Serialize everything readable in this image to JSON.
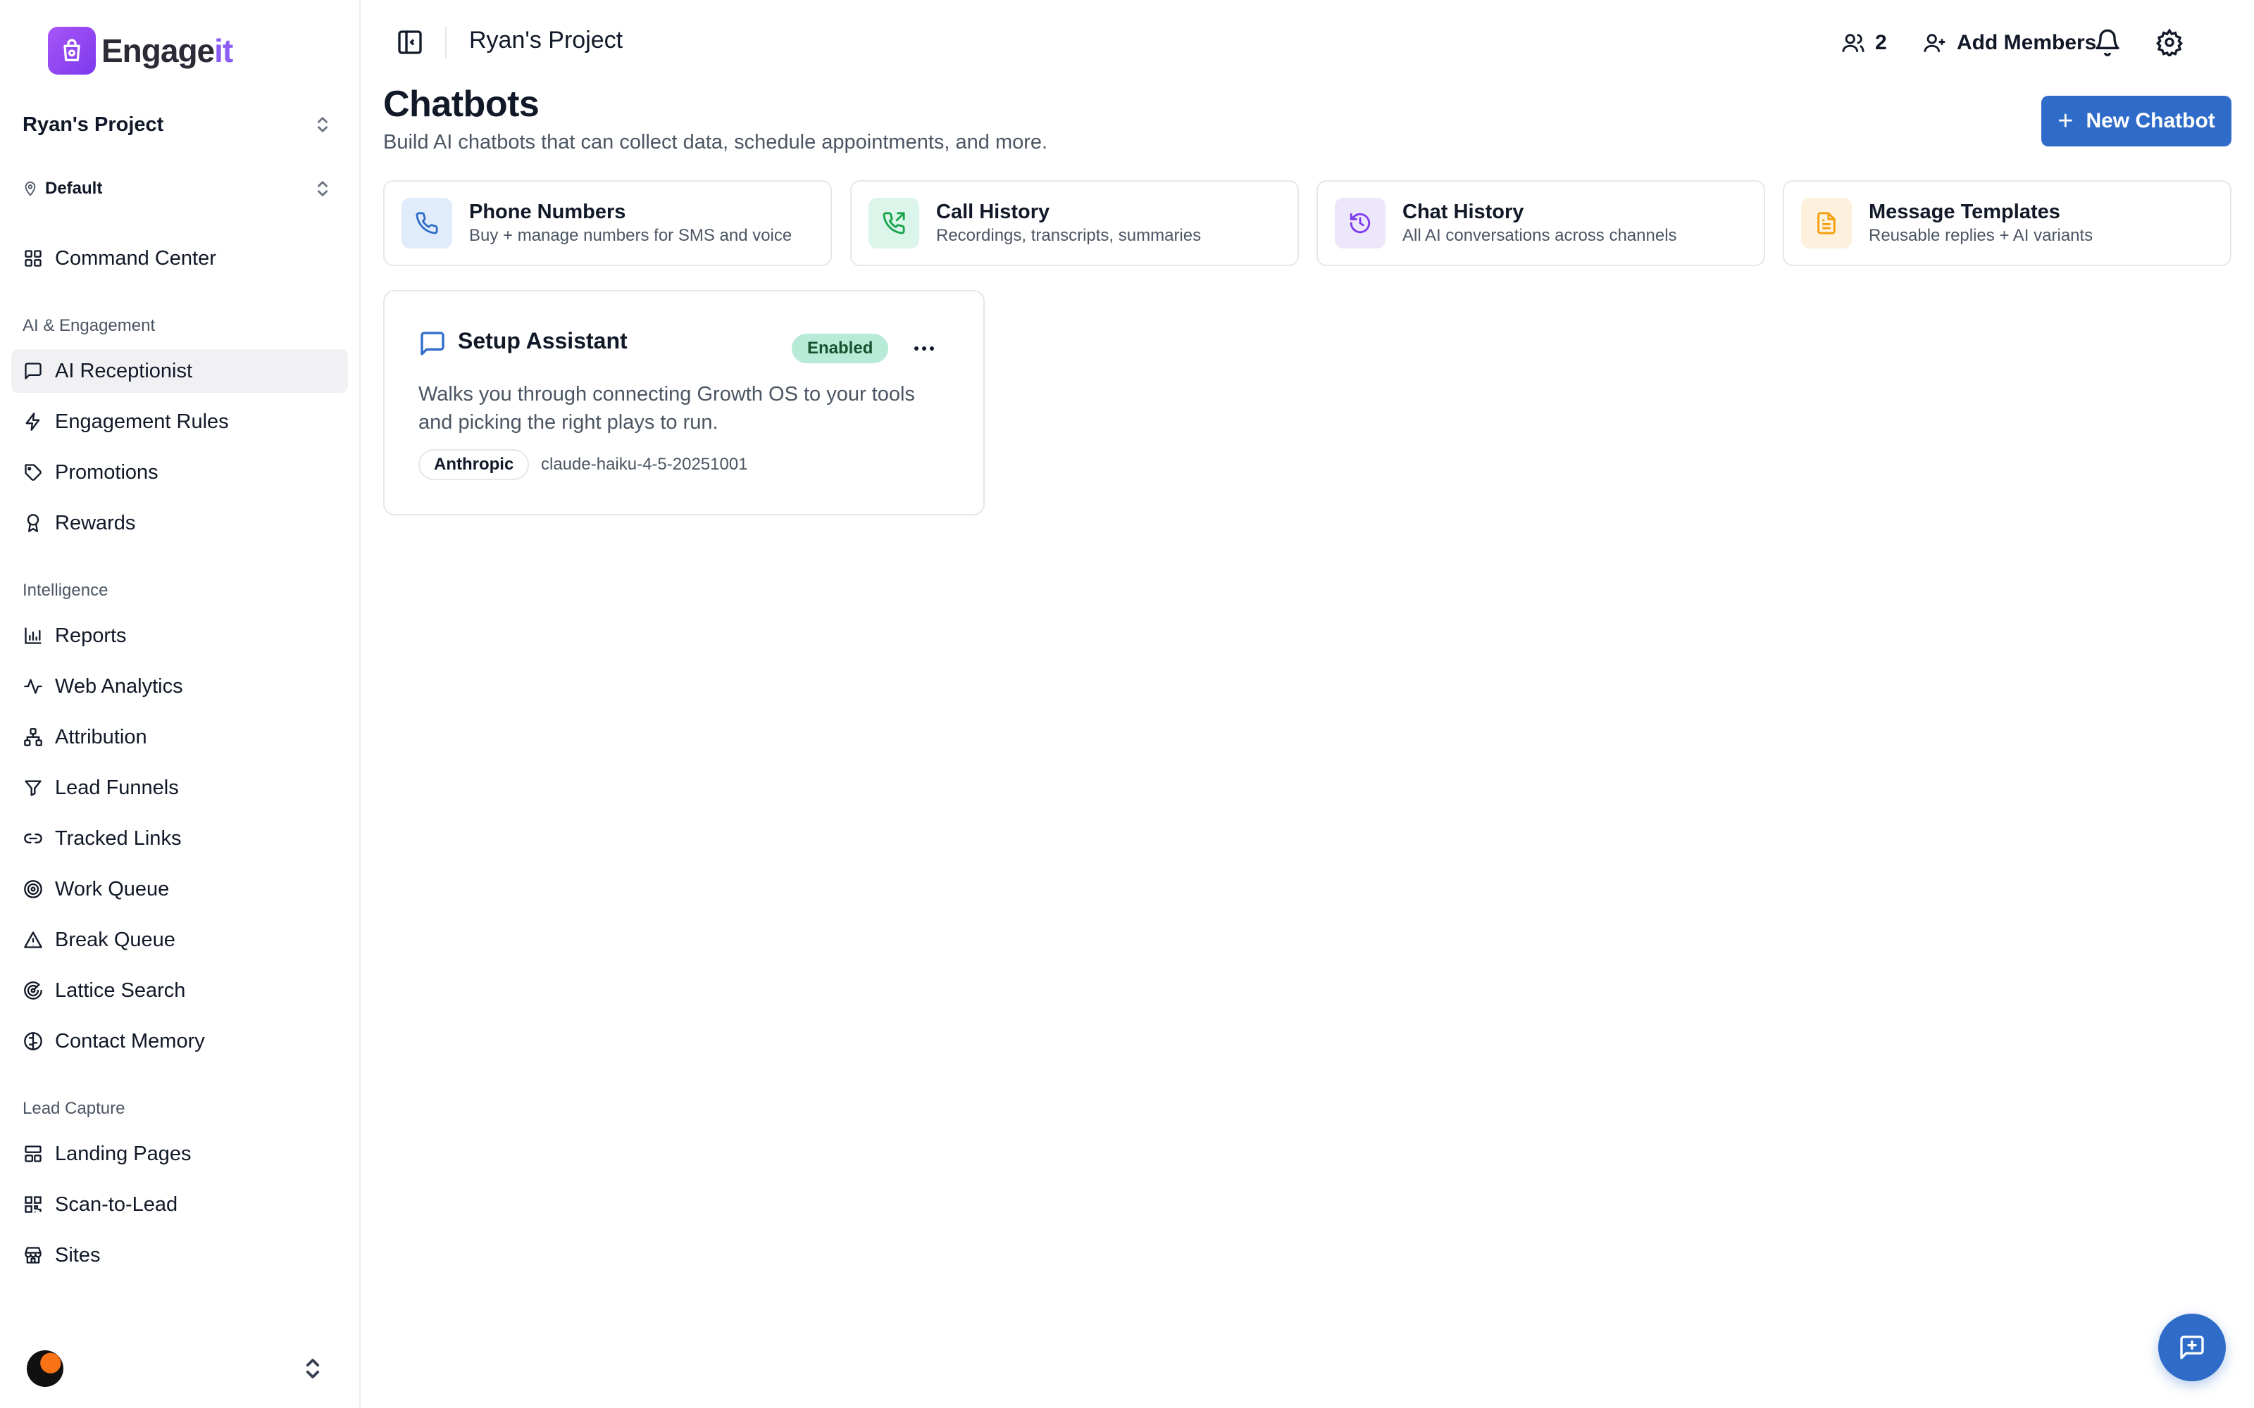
{
  "brand": {
    "name_main": "Engage",
    "name_accent": "it"
  },
  "sidebar": {
    "project": "Ryan's Project",
    "location": "Default",
    "top_item": "Command Center",
    "sections": [
      {
        "title": "AI & Engagement",
        "items": [
          "AI Receptionist",
          "Engagement Rules",
          "Promotions",
          "Rewards"
        ]
      },
      {
        "title": "Intelligence",
        "items": [
          "Reports",
          "Web Analytics",
          "Attribution",
          "Lead Funnels",
          "Tracked Links",
          "Work Queue",
          "Break Queue",
          "Lattice Search",
          "Contact Memory"
        ]
      },
      {
        "title": "Lead Capture",
        "items": [
          "Landing Pages",
          "Scan-to-Lead",
          "Sites"
        ]
      }
    ],
    "active_item": "AI Receptionist"
  },
  "topbar": {
    "title": "Ryan's Project",
    "members_count": "2",
    "add_members_label": "Add Members"
  },
  "main": {
    "title": "Chatbots",
    "subtitle": "Build AI chatbots that can collect data, schedule appointments, and more.",
    "new_button_label": "New Chatbot",
    "quick_links": [
      {
        "title": "Phone Numbers",
        "subtitle": "Buy + manage numbers for SMS and voice",
        "icon": "phone-icon",
        "bg": "#e0ecfb",
        "fg": "#2f6cc9"
      },
      {
        "title": "Call History",
        "subtitle": "Recordings, transcripts, summaries",
        "icon": "phone-outgoing-icon",
        "bg": "#dcf5ea",
        "fg": "#16a34a"
      },
      {
        "title": "Chat History",
        "subtitle": "All AI conversations across channels",
        "icon": "history-icon",
        "bg": "#ede7fb",
        "fg": "#7c3aed"
      },
      {
        "title": "Message Templates",
        "subtitle": "Reusable replies + AI variants",
        "icon": "document-icon",
        "bg": "#fdf0dc",
        "fg": "#f59e0b"
      }
    ],
    "chatbot": {
      "name": "Setup Assistant",
      "status": "Enabled",
      "description": "Walks you through connecting Growth OS to your tools and picking the right plays to run.",
      "provider": "Anthropic",
      "model": "claude-haiku-4-5-20251001"
    }
  },
  "colors": {
    "accent": "#2f6cc9",
    "brand_purple": "#8b5cf6",
    "enabled_badge": "#b7ead7"
  }
}
